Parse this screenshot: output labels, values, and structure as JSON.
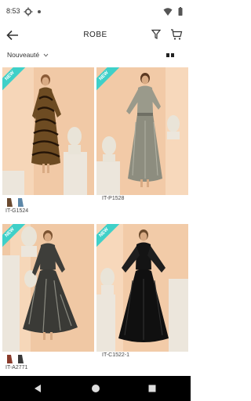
{
  "status_bar": {
    "time": "8:53",
    "icons": [
      "gear-icon",
      "notification-dot-icon",
      "wifi-icon",
      "battery-icon"
    ]
  },
  "app_bar": {
    "title": "ROBE",
    "icons": [
      "back-arrow-icon",
      "filter-icon",
      "shopping-bag-icon"
    ]
  },
  "sort_bar": {
    "sort_label": "Nouveauté",
    "icons": [
      "chevron-down-icon",
      "grid-view-icon"
    ]
  },
  "products": [
    {
      "badge": "NEW",
      "reference": "IT-G1524",
      "swatches": [
        "#6a4a30",
        "#5d87a8"
      ],
      "colors": {
        "background": "#f1c9a6",
        "dress": "#6d4b22"
      }
    },
    {
      "badge": "NEW",
      "reference": "IT-P1528",
      "swatches": [],
      "colors": {
        "background": "#f2caa7",
        "dress": "#9a9a8b"
      }
    },
    {
      "badge": "NEW",
      "reference": "IT-A2771",
      "swatches": [
        "#8a3b2b",
        "#3a3a3a"
      ],
      "colors": {
        "background": "#f0c8a4",
        "dress": "#3e3e3a"
      }
    },
    {
      "badge": "NEW",
      "reference": "IT-C1522-1",
      "swatches": [],
      "colors": {
        "background": "#f2cba8",
        "dress": "#141414"
      }
    }
  ],
  "colors": {
    "badge": "#3fd0c8",
    "nav_bar": "#000000"
  },
  "nav_bar": {
    "icons": [
      "back-triangle-icon",
      "home-circle-icon",
      "recents-square-icon"
    ]
  }
}
